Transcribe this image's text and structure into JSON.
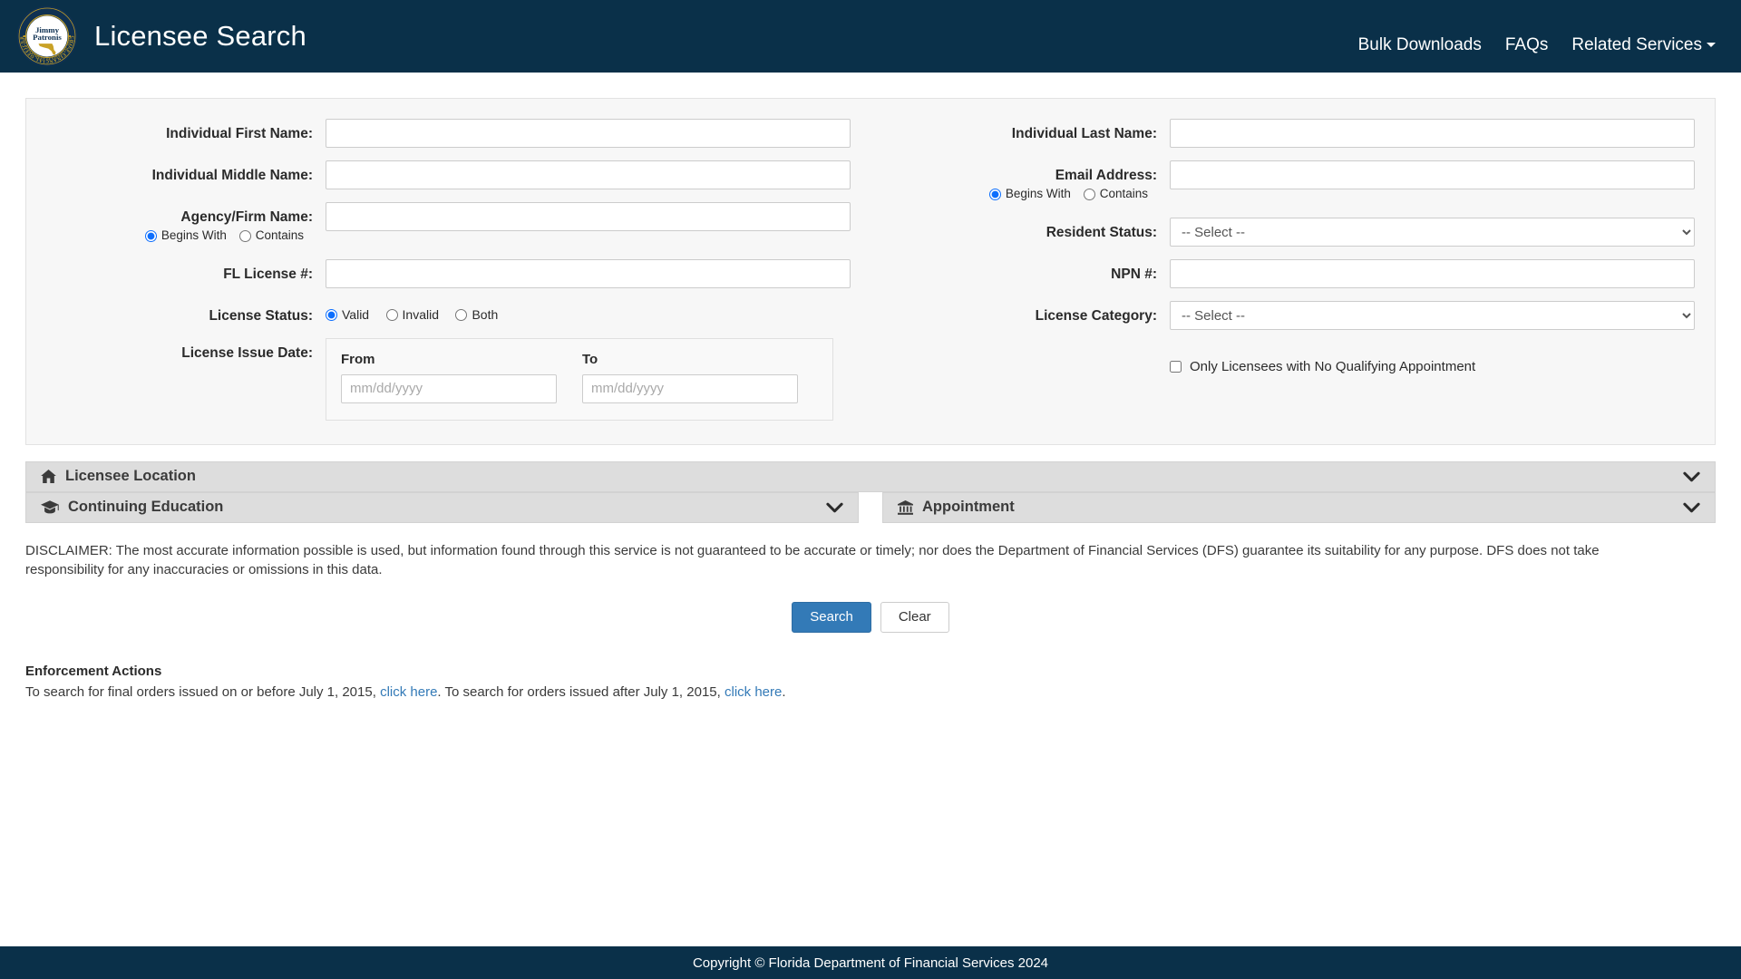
{
  "header": {
    "title": "Licensee Search",
    "logo": {
      "top_text": "CHIEF FINANCIAL OFFICER",
      "bottom_text": "FLORIDA DEPARTMENT OF FINANCIAL SERVICES",
      "name_line1": "Jimmy",
      "name_line2": "Patronis"
    },
    "nav": [
      {
        "label": "Bulk Downloads",
        "has_caret": false
      },
      {
        "label": "FAQs",
        "has_caret": false
      },
      {
        "label": "Related Services",
        "has_caret": true
      }
    ]
  },
  "form": {
    "left": {
      "first_name_label": "Individual First Name:",
      "first_name_value": "",
      "middle_name_label": "Individual Middle Name:",
      "middle_name_value": "",
      "agency_label": "Agency/Firm Name:",
      "agency_value": "",
      "agency_match_begins": "Begins With",
      "agency_match_contains": "Contains",
      "agency_match_selected": "Begins With",
      "fl_license_label": "FL License #:",
      "fl_license_value": "",
      "license_status_label": "License Status:",
      "license_status_options": [
        "Valid",
        "Invalid",
        "Both"
      ],
      "license_status_selected": "Valid",
      "issue_date_label": "License Issue Date:",
      "issue_date_from_label": "From",
      "issue_date_from_value": "",
      "issue_date_from_placeholder": "mm/dd/yyyy",
      "issue_date_to_label": "To",
      "issue_date_to_value": "",
      "issue_date_to_placeholder": "mm/dd/yyyy"
    },
    "right": {
      "last_name_label": "Individual Last Name:",
      "last_name_value": "",
      "email_label": "Email Address:",
      "email_value": "",
      "email_match_begins": "Begins With",
      "email_match_contains": "Contains",
      "email_match_selected": "Begins With",
      "resident_status_label": "Resident Status:",
      "resident_status_selected": "-- Select --",
      "resident_status_options": [
        "-- Select --"
      ],
      "npn_label": "NPN #:",
      "npn_value": "",
      "license_category_label": "License Category:",
      "license_category_selected": "-- Select --",
      "license_category_options": [
        "-- Select --"
      ],
      "no_qualifying_appointment_label": "Only Licensees with No Qualifying Appointment",
      "no_qualifying_appointment_checked": false
    }
  },
  "accordions": [
    {
      "label": "Licensee Location",
      "icon": "home-icon",
      "expanded": false
    },
    {
      "label": "Continuing Education",
      "icon": "graduation-cap-icon",
      "expanded": false
    },
    {
      "label": "Appointment",
      "icon": "bank-icon",
      "expanded": false
    }
  ],
  "disclaimer": "DISCLAIMER: The most accurate information possible is used, but information found through this service is not guaranteed to be accurate or timely; nor does the Department of Financial Services (DFS) guarantee its suitability for any purpose. DFS does not take responsibility for any inaccuracies or omissions in this data.",
  "buttons": {
    "search_label": "Search",
    "clear_label": "Clear"
  },
  "enforcement": {
    "title": "Enforcement Actions",
    "text_part1": "To search for final orders issued on or before July 1, 2015, ",
    "link1_label": "click here",
    "text_part2": ". To search for orders issued after July 1, 2015, ",
    "link2_label": "click here",
    "text_part3": "."
  },
  "footer": {
    "copyright": "Copyright © Florida Department of Financial Services 2024"
  },
  "colors": {
    "header_navy": "#0a3049",
    "accent_blue": "#337ab7",
    "panel_gray": "#f7f7f7",
    "accordion_gray": "#dddddd",
    "seal_gold": "#c9a227"
  }
}
